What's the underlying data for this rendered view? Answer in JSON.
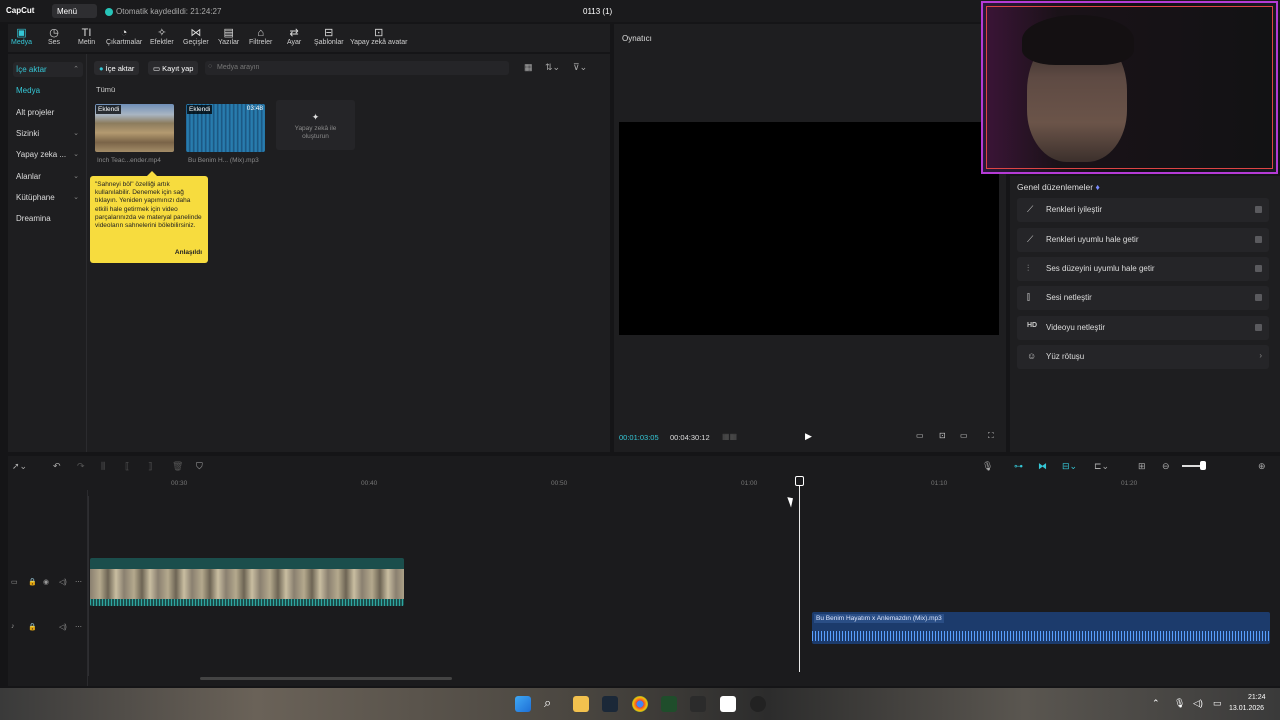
{
  "app": {
    "logo": "CapCut",
    "menu_label": "Menü",
    "autosave": "Otomatik kaydedildi: 21:24:27",
    "project_title": "0113 (1)"
  },
  "toolbar": {
    "items": [
      {
        "label": "Medya",
        "icon": "media-icon"
      },
      {
        "label": "Ses",
        "icon": "audio-icon"
      },
      {
        "label": "Metin",
        "icon": "text-icon"
      },
      {
        "label": "Çıkartmalar",
        "icon": "sticker-icon"
      },
      {
        "label": "Efektler",
        "icon": "effects-icon"
      },
      {
        "label": "Geçişler",
        "icon": "transitions-icon"
      },
      {
        "label": "Yazılar",
        "icon": "captions-icon"
      },
      {
        "label": "Filtreler",
        "icon": "filters-icon"
      },
      {
        "label": "Ayar",
        "icon": "adjust-icon"
      },
      {
        "label": "Şablonlar",
        "icon": "templates-icon"
      },
      {
        "label": "Yapay zekâ avatar",
        "icon": "ai-avatar-icon"
      }
    ]
  },
  "sidenav": {
    "items": [
      {
        "label": "İçe aktar",
        "chev": "⌃"
      },
      {
        "label": "Medya",
        "chev": ""
      },
      {
        "label": "Alt projeler",
        "chev": ""
      },
      {
        "label": "Sizinki",
        "chev": "⌄"
      },
      {
        "label": "Yapay zeka ...",
        "chev": "⌄"
      },
      {
        "label": "Alanlar",
        "chev": "⌄"
      },
      {
        "label": "Kütüphane",
        "chev": "⌄"
      },
      {
        "label": "Dreamina",
        "chev": ""
      }
    ]
  },
  "media": {
    "import_label": "İçe aktar",
    "record_label": "Kayıt yap",
    "search_placeholder": "Medya arayın",
    "filter_label": "Tümü",
    "items": [
      {
        "badge": "Eklendi",
        "caption": "Inch Teac...ender.mp4",
        "duration": ""
      },
      {
        "badge": "Eklendi",
        "caption": "Bu Benim H... (Mix).mp3",
        "duration": "03:48"
      }
    ],
    "ai_create": "Yapay zekâ ile oluşturun"
  },
  "tooltip": {
    "text": "\"Sahneyi böl\" özelliği artık kullanılabilir. Denemek için sağ tıklayın. Yeniden yapımınızı daha etkili hale getirmek için video parçalarınızda ve materyal panelinde videoların sahnelerini bölebilirsiniz.",
    "button": "Anlaşıldı"
  },
  "player": {
    "title": "Oynatıcı",
    "time_current": "00:01:03:05",
    "time_total": "00:04:30:12"
  },
  "adjust_panel": {
    "title": "Genel düzenlemeler",
    "options": [
      {
        "label": "Renkleri iyileştir",
        "icon": "enhance-color-icon",
        "control": "toggle"
      },
      {
        "label": "Renkleri uyumlu hale getir",
        "icon": "color-match-icon",
        "control": "toggle"
      },
      {
        "label": "Ses düzeyini uyumlu hale getir",
        "icon": "volume-normalize-icon",
        "control": "toggle"
      },
      {
        "label": "Sesi netleştir",
        "icon": "audio-enhance-icon",
        "control": "toggle"
      },
      {
        "label": "Videoyu netleştir",
        "icon": "hd-icon",
        "control": "toggle"
      },
      {
        "label": "Yüz rötuşu",
        "icon": "face-retouch-icon",
        "control": "chevron"
      }
    ]
  },
  "timeline": {
    "ticks": [
      "00:30",
      "00:40",
      "00:50",
      "01:00",
      "01:10",
      "01:20"
    ],
    "audio_clip_label": "Bu Benim Hayatım x Anlemazdın (Mix).mp3"
  },
  "taskbar": {
    "time": "21:24",
    "date": "13.01.2026"
  },
  "colors": {
    "accent": "#35c7d6",
    "tooltip_bg": "#f7dc3e",
    "video_clip": "#1b4e4c",
    "audio_clip": "#1c3b6c",
    "webcam_border": "#b53bd6"
  }
}
